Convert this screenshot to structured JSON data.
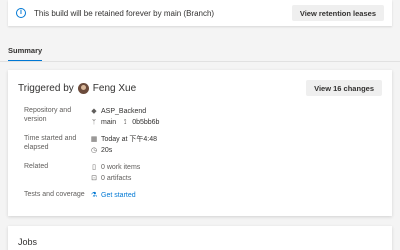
{
  "banner": {
    "message": "This build will be retained forever by main (Branch)",
    "button": "View retention leases"
  },
  "tabs": [
    {
      "label": "Summary",
      "selected": true
    }
  ],
  "summary": {
    "title_prefix": "Triggered by",
    "user": "Feng Xue",
    "changes_button": "View 16 changes",
    "rows": {
      "repo_label": "Repository and version",
      "repo_name": "ASP_Backend",
      "branch": "main",
      "commit": "0b5bb6b",
      "time_label": "Time started and elapsed",
      "started": "Today at 下午4:48",
      "elapsed": "20s",
      "related_label": "Related",
      "work_items": "0 work items",
      "artifacts": "0 artifacts",
      "tests_label": "Tests and coverage",
      "get_started": "Get started"
    }
  },
  "jobs": {
    "title": "Jobs"
  },
  "colors": {
    "accent": "#0078d4",
    "background": "#f4f4f4",
    "card": "#ffffff"
  }
}
